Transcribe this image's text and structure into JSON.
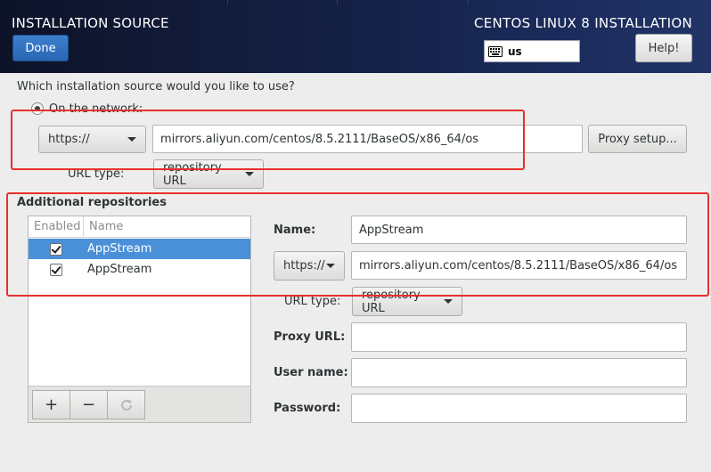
{
  "header": {
    "title": "INSTALLATION SOURCE",
    "product": "CENTOS LINUX 8 INSTALLATION",
    "done_label": "Done",
    "help_label": "Help!",
    "keyboard_layout": "us"
  },
  "source": {
    "question": "Which installation source would you like to use?",
    "network_option": "On the network:",
    "protocol": "https://",
    "url": "mirrors.aliyun.com/centos/8.5.2111/BaseOS/x86_64/os",
    "proxy_button": "Proxy setup...",
    "url_type_label": "URL type:",
    "url_type_value": "repository URL"
  },
  "repos": {
    "section_title": "Additional repositories",
    "columns": {
      "enabled": "Enabled",
      "name": "Name"
    },
    "items": [
      {
        "name": "AppStream",
        "enabled": true,
        "selected": true
      },
      {
        "name": "AppStream",
        "enabled": true,
        "selected": false
      }
    ],
    "toolbar": {
      "add": "+",
      "remove": "−"
    }
  },
  "details": {
    "name_label": "Name:",
    "name_value": "AppStream",
    "protocol": "https://",
    "url": "mirrors.aliyun.com/centos/8.5.2111/BaseOS/x86_64/os",
    "url_type_label": "URL type:",
    "url_type_value": "repository URL",
    "proxy_url_label": "Proxy URL:",
    "proxy_url_value": "",
    "user_name_label": "User name:",
    "user_name_value": "",
    "password_label": "Password:",
    "password_value": ""
  },
  "colors": {
    "accent": "#4a90d9",
    "header_bg": "#16224a",
    "annotation": "#e8302c"
  }
}
